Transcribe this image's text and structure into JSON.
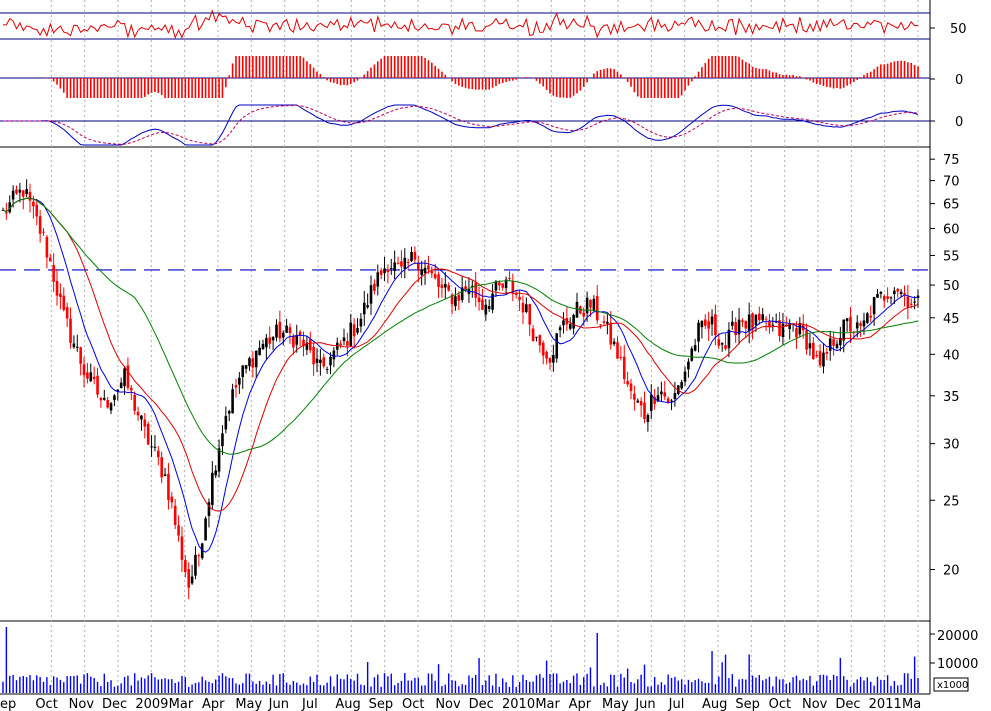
{
  "chart_data": {
    "type": "candlestick",
    "price_scale": "log",
    "price_ylim": [
      17,
      78
    ],
    "price_ticks": [
      20,
      25,
      30,
      35,
      40,
      45,
      50,
      55,
      60,
      65,
      70,
      75
    ],
    "resistance_level": 52.5,
    "x_labels": [
      "ep",
      "Oct",
      "Nov",
      "Dec",
      "2009",
      "Mar",
      "Apr",
      "May",
      "Jun",
      "Jul",
      "Aug",
      "Sep",
      "Oct",
      "Nov",
      "Dec",
      "2010",
      "Mar",
      "Apr",
      "May",
      "Jun",
      "Jul",
      "Aug",
      "Sep",
      "Oct",
      "Nov",
      "Dec",
      "2011",
      "Ma"
    ],
    "price_keypoints": [
      [
        0,
        63
      ],
      [
        6,
        68
      ],
      [
        12,
        58
      ],
      [
        18,
        45
      ],
      [
        24,
        38
      ],
      [
        30,
        34
      ],
      [
        36,
        37
      ],
      [
        42,
        31
      ],
      [
        48,
        27
      ],
      [
        52,
        22
      ],
      [
        55,
        19
      ],
      [
        58,
        21
      ],
      [
        62,
        27
      ],
      [
        66,
        33
      ],
      [
        70,
        37
      ],
      [
        76,
        41
      ],
      [
        82,
        43
      ],
      [
        88,
        42
      ],
      [
        94,
        38
      ],
      [
        100,
        41
      ],
      [
        106,
        45
      ],
      [
        110,
        50
      ],
      [
        114,
        54
      ],
      [
        118,
        52
      ],
      [
        122,
        55
      ],
      [
        126,
        52
      ],
      [
        130,
        49
      ],
      [
        134,
        48
      ],
      [
        138,
        50
      ],
      [
        142,
        47
      ],
      [
        146,
        49
      ],
      [
        150,
        50
      ],
      [
        154,
        47
      ],
      [
        158,
        42
      ],
      [
        162,
        40
      ],
      [
        166,
        44
      ],
      [
        170,
        46
      ],
      [
        174,
        47
      ],
      [
        178,
        44
      ],
      [
        182,
        40
      ],
      [
        186,
        35
      ],
      [
        190,
        33
      ],
      [
        194,
        36
      ],
      [
        198,
        34
      ],
      [
        202,
        38
      ],
      [
        206,
        43
      ],
      [
        210,
        44
      ],
      [
        214,
        41
      ],
      [
        218,
        45
      ],
      [
        222,
        44
      ],
      [
        226,
        44
      ],
      [
        230,
        43
      ],
      [
        234,
        44
      ],
      [
        238,
        42
      ],
      [
        242,
        38
      ],
      [
        246,
        42
      ],
      [
        250,
        44
      ],
      [
        254,
        43
      ],
      [
        258,
        47
      ],
      [
        262,
        49
      ],
      [
        264,
        50
      ],
      [
        266,
        49
      ],
      [
        270,
        47
      ]
    ],
    "indicators": {
      "rsi_label": "50",
      "macd_hist_label": "0",
      "macd_line_label": "0"
    },
    "volume_ticks": [
      "20000",
      "10000"
    ],
    "volume_unit": "x1000",
    "series": [
      {
        "name": "",
        "color": "#0000e0"
      },
      {
        "name": "",
        "color": "#e00000"
      },
      {
        "name": "",
        "color": "#008000"
      }
    ]
  }
}
